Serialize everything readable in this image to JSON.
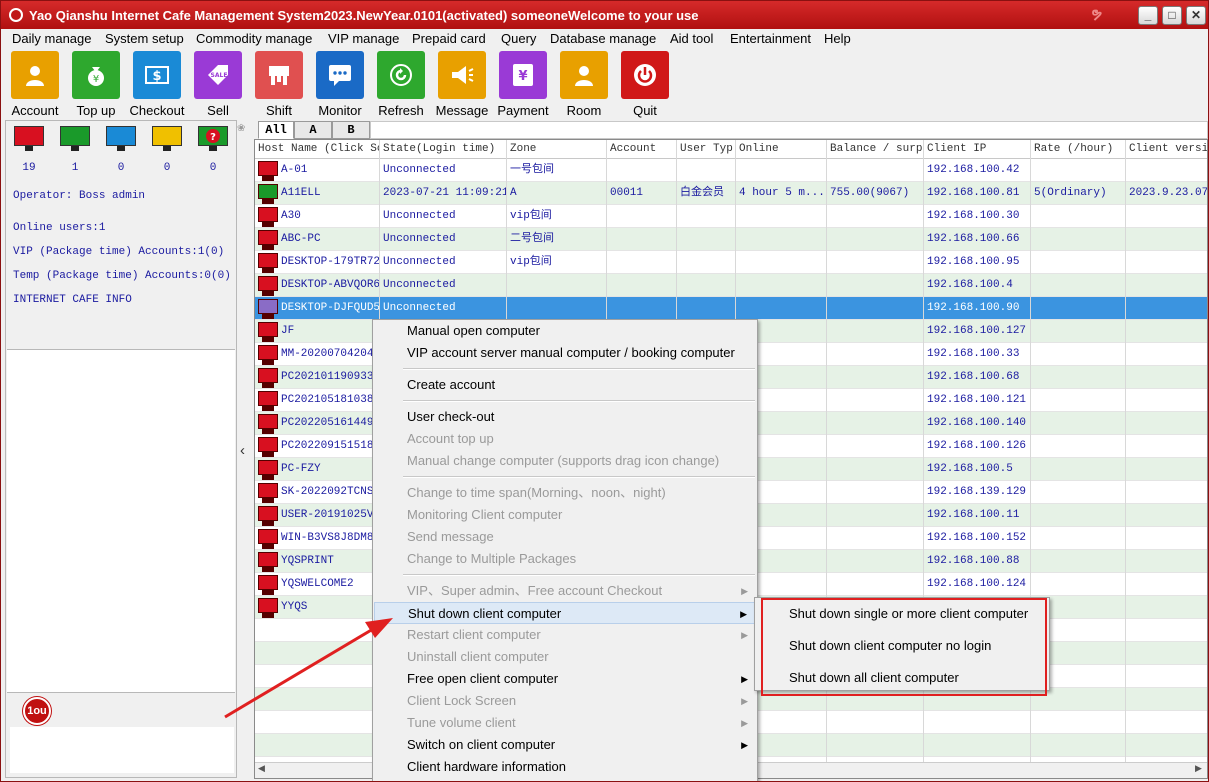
{
  "window": {
    "title": "Yao Qianshu Internet Cafe Management System2023.NewYear.0101(activated)  someoneWelcome to your use",
    "controls": [
      "minimize-icon",
      "maximize-icon",
      "close-icon"
    ]
  },
  "menubar": {
    "items": [
      "Daily manage",
      "System setup",
      "Commodity manage",
      "VIP manage",
      "Prepaid card",
      "Query",
      "Database manage",
      "Aid tool",
      "Entertainment",
      "Help"
    ]
  },
  "toolbar": {
    "buttons": [
      {
        "label": "Account",
        "icon": "person-icon",
        "color": "#e8a000"
      },
      {
        "label": "Top up",
        "icon": "money-bag-icon",
        "color": "#2ea82e"
      },
      {
        "label": "Checkout",
        "icon": "dollar-card-icon",
        "color": "#1a8ad6"
      },
      {
        "label": "Sell",
        "icon": "sale-tag-icon",
        "color": "#9a3ad6"
      },
      {
        "label": "Shift",
        "icon": "shift-icon",
        "color": "#e05050"
      },
      {
        "label": "Monitor",
        "icon": "chat-monitor-icon",
        "color": "#1a6ac6"
      },
      {
        "label": "Refresh",
        "icon": "refresh-icon",
        "color": "#2ea82e"
      },
      {
        "label": "Message",
        "icon": "megaphone-icon",
        "color": "#e8a000"
      },
      {
        "label": "Payment",
        "icon": "yen-payment-icon",
        "color": "#9a3ad6"
      },
      {
        "label": "Room",
        "icon": "person-icon",
        "color": "#e8a000"
      },
      {
        "label": "Quit",
        "icon": "power-icon",
        "color": "#d01818"
      }
    ]
  },
  "status_counts": [
    {
      "color": "#d81020",
      "count": "19",
      "icon": "monitor-red-icon"
    },
    {
      "color": "#1a9a2a",
      "count": "1",
      "icon": "monitor-green-icon"
    },
    {
      "color": "#1a8ad6",
      "count": "0",
      "icon": "monitor-blue-icon"
    },
    {
      "color": "#f0c000",
      "count": "0",
      "icon": "monitor-yellow-icon"
    },
    {
      "color": "#1a9a2a",
      "count": "0",
      "icon": "monitor-question-icon"
    }
  ],
  "info": {
    "operator": "Operator: Boss admin",
    "online_users": "Online users:1",
    "vip_accounts": "VIP (Package time) Accounts:1(0)",
    "temp_accounts": "Temp (Package time) Accounts:0(0)",
    "cafe_info": "INTERNET CAFE  INFO"
  },
  "logo_text": "1ou",
  "tabs": [
    "All",
    "A",
    "B"
  ],
  "grid": {
    "columns": [
      "Host Name (Click Sc",
      "State(Login time)",
      "Zone",
      "Account",
      "User Typ",
      "Online",
      "Balance / surp",
      "Client IP",
      "Rate (/hour)",
      "Client versio"
    ],
    "rows": [
      {
        "host": "A-01",
        "state": "Unconnected",
        "zone": "一号包间",
        "account": "",
        "user_type": "",
        "online": "",
        "balance": "",
        "ip": "192.168.100.42",
        "rate": "",
        "version": "",
        "status": "red"
      },
      {
        "host": "A11ELL",
        "state": "2023-07-21 11:09:21",
        "zone": "A",
        "account": "00011",
        "user_type": "白金会员",
        "online": "4 hour 5 m...",
        "balance": "755.00(9067)",
        "ip": "192.168.100.81",
        "rate": "5(Ordinary)",
        "version": "2023.9.23.0710",
        "status": "green"
      },
      {
        "host": "A30",
        "state": "Unconnected",
        "zone": "vip包间",
        "account": "",
        "user_type": "",
        "online": "",
        "balance": "",
        "ip": "192.168.100.30",
        "rate": "",
        "version": "",
        "status": "red"
      },
      {
        "host": "ABC-PC",
        "state": "Unconnected",
        "zone": "二号包间",
        "account": "",
        "user_type": "",
        "online": "",
        "balance": "",
        "ip": "192.168.100.66",
        "rate": "",
        "version": "",
        "status": "red"
      },
      {
        "host": "DESKTOP-179TR72",
        "state": "Unconnected",
        "zone": "vip包间",
        "account": "",
        "user_type": "",
        "online": "",
        "balance": "",
        "ip": "192.168.100.95",
        "rate": "",
        "version": "",
        "status": "red"
      },
      {
        "host": "DESKTOP-ABVQOR6",
        "state": "Unconnected",
        "zone": "",
        "account": "",
        "user_type": "",
        "online": "",
        "balance": "",
        "ip": "192.168.100.4",
        "rate": "",
        "version": "",
        "status": "red"
      },
      {
        "host": "DESKTOP-DJFQUD5",
        "state": "Unconnected",
        "zone": "",
        "account": "",
        "user_type": "",
        "online": "",
        "balance": "",
        "ip": "192.168.100.90",
        "rate": "",
        "version": "",
        "status": "selected"
      },
      {
        "host": "JF",
        "state": "",
        "zone": "",
        "account": "",
        "user_type": "",
        "online": "",
        "balance": "",
        "ip": "192.168.100.127",
        "rate": "",
        "version": "",
        "status": "red"
      },
      {
        "host": "MM-202007042048",
        "state": "",
        "zone": "",
        "account": "",
        "user_type": "",
        "online": "",
        "balance": "",
        "ip": "192.168.100.33",
        "rate": "",
        "version": "",
        "status": "red"
      },
      {
        "host": "PC202101190933",
        "state": "",
        "zone": "",
        "account": "",
        "user_type": "",
        "online": "",
        "balance": "",
        "ip": "192.168.100.68",
        "rate": "",
        "version": "",
        "status": "red"
      },
      {
        "host": "PC202105181038",
        "state": "",
        "zone": "",
        "account": "",
        "user_type": "",
        "online": "",
        "balance": "",
        "ip": "192.168.100.121",
        "rate": "",
        "version": "",
        "status": "red"
      },
      {
        "host": "PC202205161449",
        "state": "",
        "zone": "",
        "account": "",
        "user_type": "",
        "online": "",
        "balance": "",
        "ip": "192.168.100.140",
        "rate": "",
        "version": "",
        "status": "red"
      },
      {
        "host": "PC202209151518",
        "state": "",
        "zone": "",
        "account": "",
        "user_type": "",
        "online": "",
        "balance": "",
        "ip": "192.168.100.126",
        "rate": "",
        "version": "",
        "status": "red"
      },
      {
        "host": "PC-FZY",
        "state": "",
        "zone": "",
        "account": "",
        "user_type": "",
        "online": "",
        "balance": "",
        "ip": "192.168.100.5",
        "rate": "",
        "version": "",
        "status": "red"
      },
      {
        "host": "SK-2022092TCNSJ",
        "state": "",
        "zone": "",
        "account": "",
        "user_type": "",
        "online": "",
        "balance": "",
        "ip": "192.168.139.129",
        "rate": "",
        "version": "",
        "status": "red"
      },
      {
        "host": "USER-20191025VU",
        "state": "",
        "zone": "",
        "account": "",
        "user_type": "",
        "online": "",
        "balance": "",
        "ip": "192.168.100.11",
        "rate": "",
        "version": "",
        "status": "red"
      },
      {
        "host": "WIN-B3VS8J8DM83",
        "state": "",
        "zone": "",
        "account": "",
        "user_type": "",
        "online": "",
        "balance": "",
        "ip": "192.168.100.152",
        "rate": "",
        "version": "",
        "status": "red"
      },
      {
        "host": "YQSPRINT",
        "state": "",
        "zone": "",
        "account": "",
        "user_type": "",
        "online": "",
        "balance": "",
        "ip": "192.168.100.88",
        "rate": "",
        "version": "",
        "status": "red"
      },
      {
        "host": "YQSWELCOME2",
        "state": "",
        "zone": "",
        "account": "",
        "user_type": "",
        "online": "",
        "balance": "",
        "ip": "192.168.100.124",
        "rate": "",
        "version": "",
        "status": "red"
      },
      {
        "host": "YYQS",
        "state": "",
        "zone": "",
        "account": "",
        "user_type": "",
        "online": "",
        "balance": "",
        "ip": "",
        "rate": "",
        "version": "",
        "status": "red"
      }
    ]
  },
  "context_menu": {
    "items": [
      {
        "label": "Manual open computer",
        "enabled": true,
        "submenu": false
      },
      {
        "label": "VIP account server manual computer / booking computer",
        "enabled": true,
        "submenu": false
      },
      {
        "separator": true
      },
      {
        "label": "Create account",
        "enabled": true,
        "submenu": false
      },
      {
        "separator": true
      },
      {
        "label": "User check-out",
        "enabled": true,
        "submenu": false
      },
      {
        "label": "Account top up",
        "enabled": false,
        "submenu": false
      },
      {
        "label": "Manual change computer (supports drag icon change)",
        "enabled": false,
        "submenu": false
      },
      {
        "separator": true
      },
      {
        "label": "Change to time span(Morning、noon、night)",
        "enabled": false,
        "submenu": false
      },
      {
        "label": "Monitoring Client computer",
        "enabled": false,
        "submenu": false
      },
      {
        "label": "Send message",
        "enabled": false,
        "submenu": false
      },
      {
        "label": "Change to Multiple Packages",
        "enabled": false,
        "submenu": false
      },
      {
        "separator": true
      },
      {
        "label": "VIP、Super admin、Free account Checkout",
        "enabled": false,
        "submenu": true
      },
      {
        "label": "Shut down client computer",
        "enabled": true,
        "submenu": true,
        "highlighted": true
      },
      {
        "label": "Restart client computer",
        "enabled": false,
        "submenu": true
      },
      {
        "label": "Uninstall client computer",
        "enabled": false,
        "submenu": false
      },
      {
        "label": "Free open client computer",
        "enabled": true,
        "submenu": true
      },
      {
        "label": "Client Lock Screen",
        "enabled": false,
        "submenu": true
      },
      {
        "label": "Tune  volume client",
        "enabled": false,
        "submenu": true
      },
      {
        "label": "Switch on client computer",
        "enabled": true,
        "submenu": true
      },
      {
        "label": "Client hardware information",
        "enabled": true,
        "submenu": false
      }
    ]
  },
  "submenu": {
    "items": [
      "Shut down single or more client computer",
      "Shut down client computer no login",
      "Shut down all client computer"
    ]
  },
  "colors": {
    "titlebar": "#c01818",
    "selection": "#3b94e0",
    "row_alt": "#e6f2e6",
    "highlight_box": "#e02020",
    "annotation_arrow": "#e02020"
  }
}
